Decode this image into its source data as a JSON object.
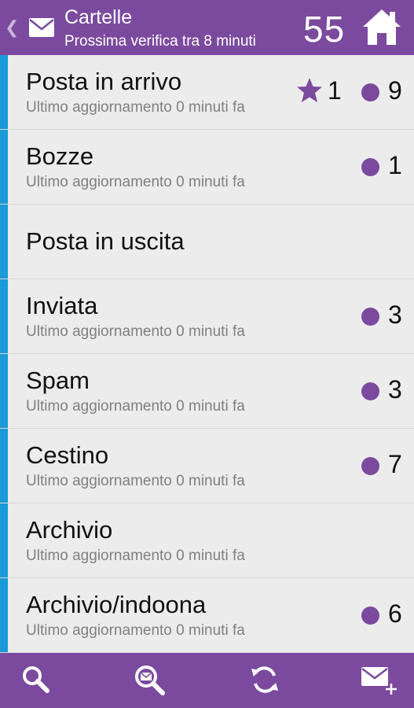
{
  "header": {
    "title": "Cartelle",
    "subtitle": "Prossima verifica tra 8 minuti",
    "count": "55",
    "back_icon": "chevron-left-icon",
    "mail_icon": "envelope-icon",
    "home_icon": "home-icon"
  },
  "folders": [
    {
      "name": "Posta in arrivo",
      "updated": "Ultimo aggiornamento 0 minuti fa",
      "starred": "1",
      "unread": "9"
    },
    {
      "name": "Bozze",
      "updated": "Ultimo aggiornamento 0 minuti fa",
      "unread": "1"
    },
    {
      "name": "Posta in uscita"
    },
    {
      "name": "Inviata",
      "updated": "Ultimo aggiornamento 0 minuti fa",
      "unread": "3"
    },
    {
      "name": "Spam",
      "updated": "Ultimo aggiornamento 0 minuti fa",
      "unread": "3"
    },
    {
      "name": "Cestino",
      "updated": "Ultimo aggiornamento 0 minuti fa",
      "unread": "7"
    },
    {
      "name": "Archivio",
      "updated": "Ultimo aggiornamento 0 minuti fa"
    },
    {
      "name": "Archivio/indoona",
      "updated": "Ultimo aggiornamento 0 minuti fa",
      "unread": "6"
    }
  ],
  "toolbar": {
    "icons": [
      "search-icon",
      "search-mail-icon",
      "refresh-icon",
      "compose-icon"
    ]
  },
  "colors": {
    "accent": "#7b4a9e",
    "stripe": "#1a9ad6",
    "background": "#ececec"
  }
}
